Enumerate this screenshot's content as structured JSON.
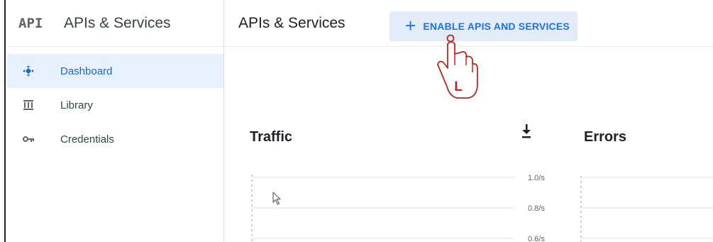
{
  "sidebar": {
    "logo": "API",
    "title": "APIs & Services",
    "items": [
      {
        "label": "Dashboard",
        "icon": "dashboard-icon",
        "active": true
      },
      {
        "label": "Library",
        "icon": "library-icon",
        "active": false
      },
      {
        "label": "Credentials",
        "icon": "key-icon",
        "active": false
      }
    ]
  },
  "header": {
    "title": "APIs & Services",
    "enable_button": {
      "plus": "+",
      "label": "ENABLE APIS AND SERVICES"
    }
  },
  "cards": {
    "traffic": {
      "title": "Traffic"
    },
    "errors": {
      "title": "Errors"
    }
  },
  "chart_data": {
    "type": "line",
    "title": "Traffic",
    "xlabel": "",
    "ylabel": "",
    "y_ticks": [
      "1.0/s",
      "0.8/s",
      "0.6/s"
    ],
    "ylim": [
      0.6,
      1.0
    ],
    "grid": true,
    "series": []
  },
  "overlay": {
    "hand_letter": "L"
  },
  "colors": {
    "accent": "#1a73e8",
    "active_bg": "#e8f0fe",
    "button_bg": "#e3ebf8",
    "hand_stroke": "#c5221f"
  }
}
